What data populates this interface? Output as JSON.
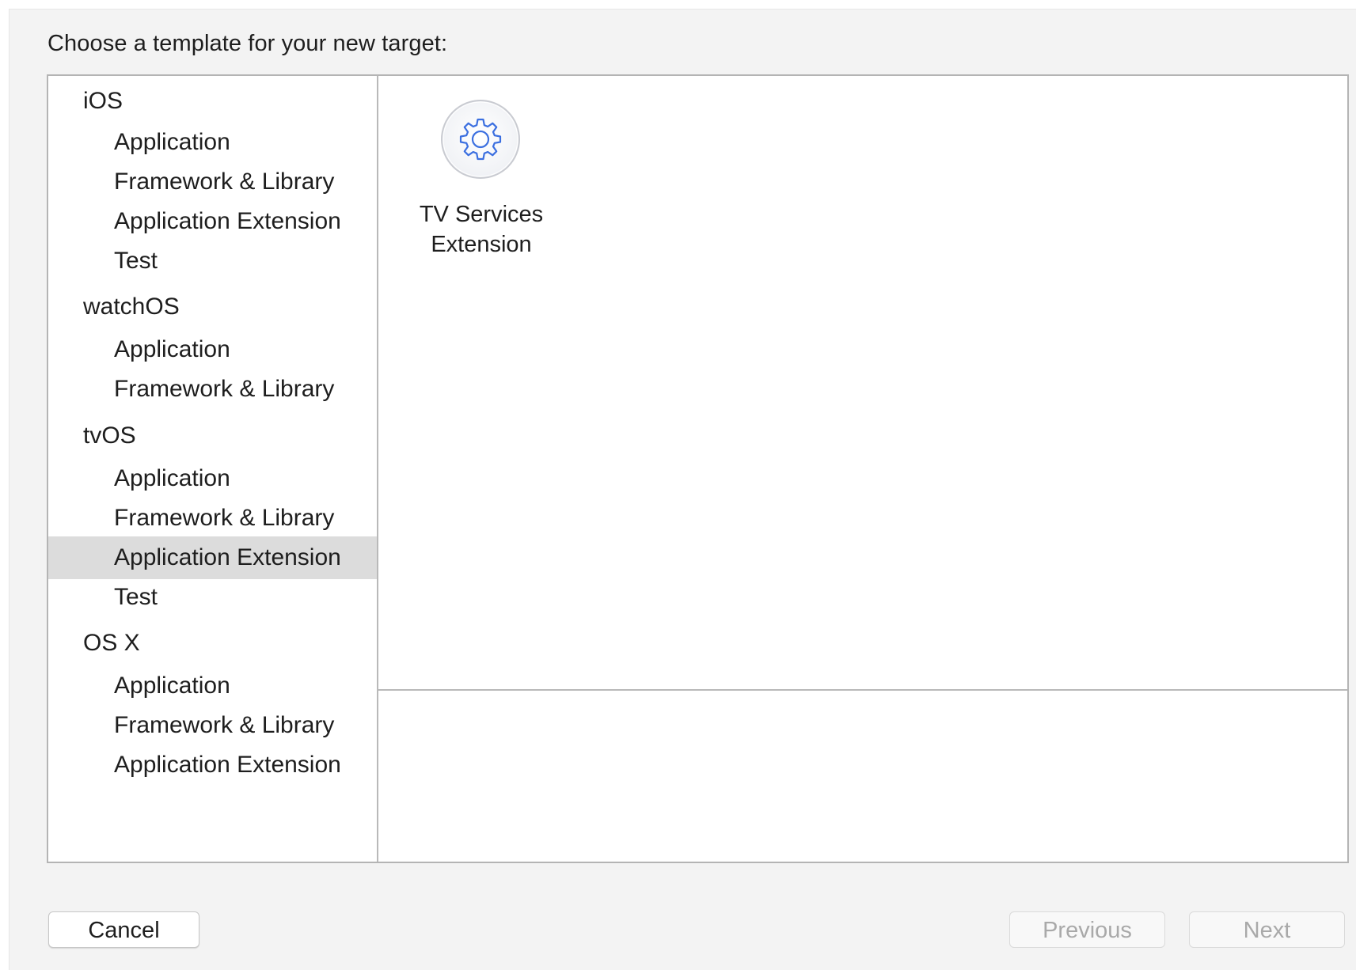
{
  "dialog": {
    "prompt": "Choose a template for your new target:"
  },
  "sidebar": {
    "groups": [
      {
        "platform": "iOS",
        "categories": [
          "Application",
          "Framework & Library",
          "Application Extension",
          "Test"
        ]
      },
      {
        "platform": "watchOS",
        "categories": [
          "Application",
          "Framework & Library"
        ]
      },
      {
        "platform": "tvOS",
        "categories": [
          "Application",
          "Framework & Library",
          "Application Extension",
          "Test"
        ]
      },
      {
        "platform": "OS X",
        "categories": [
          "Application",
          "Framework & Library",
          "Application Extension"
        ]
      }
    ],
    "selected": "tvOS / Application Extension"
  },
  "templates": [
    {
      "label_line1": "TV Services",
      "label_line2": "Extension",
      "icon": "gear-icon"
    }
  ],
  "buttons": {
    "cancel": "Cancel",
    "previous": "Previous",
    "next": "Next",
    "previous_enabled": false,
    "next_enabled": false
  },
  "colors": {
    "accent_icon": "#3b6fe0",
    "selection": "#dcdcdc",
    "disabled_text": "#a9a9a9"
  }
}
